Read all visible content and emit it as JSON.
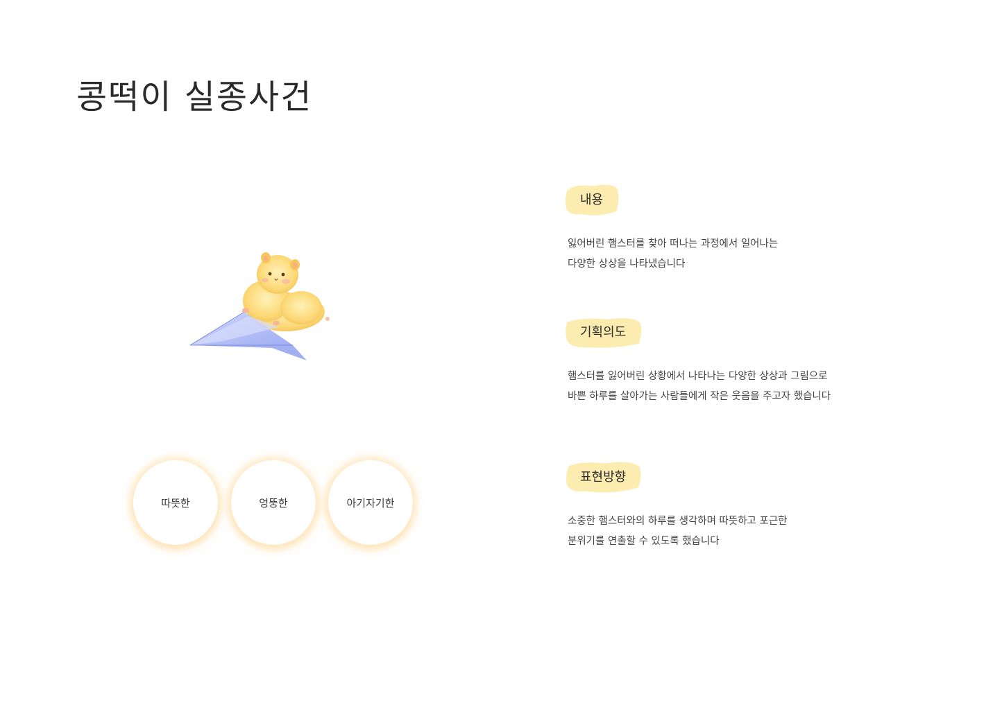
{
  "title": "콩떡이 실종사건",
  "keywords": [
    "따뜻한",
    "엉뚱한",
    "아기자기한"
  ],
  "sections": [
    {
      "heading": "내용",
      "lines": [
        "잃어버린 햄스터를 찾아 떠나는 과정에서 일어나는",
        "다양한 상상을 나타냈습니다"
      ]
    },
    {
      "heading": "기획의도",
      "lines": [
        "햄스터를 잃어버린 상황에서 나타나는 다양한 상상과 그림으로",
        "바쁜 하루를 살아가는 사람들에게 작은 웃음을 주고자 했습니다"
      ]
    },
    {
      "heading": "표현방향",
      "lines": [
        "소중한 햄스터와의 하루를 생각하며 따뜻하고 포근한",
        "분위기를 연출할 수 있도록 했습니다"
      ]
    }
  ],
  "colors": {
    "highlight": "#fde9a2",
    "keyword_glow": "#ffd68c",
    "hamster": "#fbd870",
    "plane": "#a9b6f5"
  },
  "icons": {
    "illustration": "hamster-on-paper-plane-illustration"
  }
}
